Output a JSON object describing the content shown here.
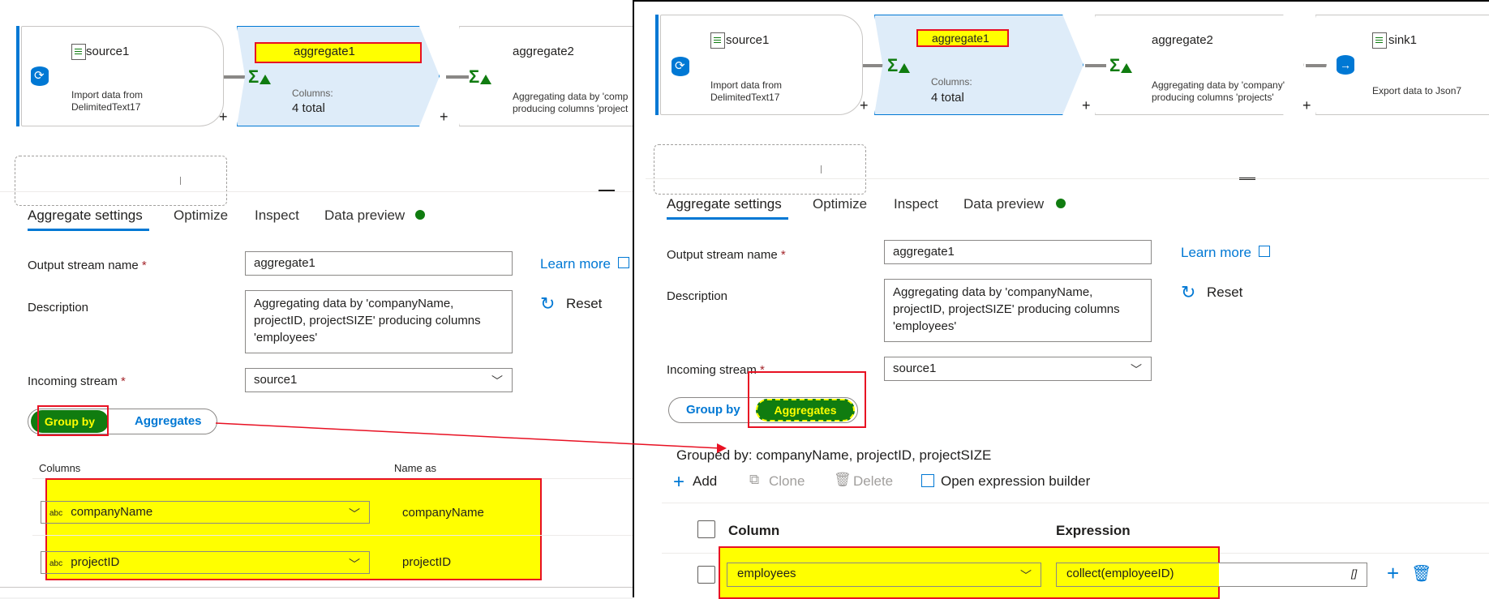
{
  "left": {
    "pipeline": {
      "nodes": [
        {
          "title": "source1",
          "desc1": "Import data from",
          "desc2": "DelimitedText17"
        },
        {
          "title": "aggregate1",
          "columns_label": "Columns:",
          "columns_total": "4 total"
        },
        {
          "title": "aggregate2",
          "desc1": "Aggregating data by 'comp",
          "desc2": "producing columns 'project"
        }
      ],
      "plus": "+"
    },
    "tabs": [
      "Aggregate settings",
      "Optimize",
      "Inspect",
      "Data preview"
    ],
    "form": {
      "output_stream_label": "Output stream name",
      "required_mark": "*",
      "output_stream_value": "aggregate1",
      "learn_more": "Learn more",
      "description_label": "Description",
      "description_value": "Aggregating data by 'companyName, projectID, projectSIZE' producing columns 'employees'",
      "reset": "Reset",
      "incoming_label": "Incoming stream",
      "incoming_value": "source1"
    },
    "toggle": {
      "group_by": "Group by",
      "aggregates": "Aggregates"
    },
    "table": {
      "col_columns": "Columns",
      "col_name_as": "Name as",
      "rows": [
        {
          "type": "abc",
          "column": "companyName",
          "name_as": "companyName"
        },
        {
          "type": "abc",
          "column": "projectID",
          "name_as": "projectID"
        }
      ]
    }
  },
  "right": {
    "pipeline": {
      "nodes": [
        {
          "title": "source1",
          "desc1": "Import data from",
          "desc2": "DelimitedText17"
        },
        {
          "title": "aggregate1",
          "columns_label": "Columns:",
          "columns_total": "4 total"
        },
        {
          "title": "aggregate2",
          "desc1": "Aggregating data by 'company'",
          "desc2": "producing columns 'projects'"
        },
        {
          "title": "sink1",
          "desc1": "Export data to Json7"
        }
      ],
      "plus": "+"
    },
    "tabs": [
      "Aggregate settings",
      "Optimize",
      "Inspect",
      "Data preview"
    ],
    "form": {
      "output_stream_label": "Output stream name",
      "required_mark": "*",
      "output_stream_value": "aggregate1",
      "learn_more": "Learn more",
      "description_label": "Description",
      "description_value": "Aggregating data by 'companyName, projectID, projectSIZE' producing columns 'employees'",
      "reset": "Reset",
      "incoming_label": "Incoming stream",
      "incoming_value": "source1"
    },
    "toggle": {
      "group_by": "Group by",
      "aggregates": "Aggregates"
    },
    "grouped_by": "Grouped by: companyName, projectID, projectSIZE",
    "toolbar": {
      "add": "Add",
      "clone": "Clone",
      "delete": "Delete",
      "open_builder": "Open expression builder"
    },
    "table": {
      "col_column": "Column",
      "col_expression": "Expression",
      "rows": [
        {
          "column": "employees",
          "expression": "collect(employeeID)",
          "array_glyph": "[]"
        }
      ]
    }
  },
  "colors": {
    "accent": "#0078d4",
    "highlight": "#ffff00",
    "annotation": "#e81123",
    "success": "#107c10"
  }
}
